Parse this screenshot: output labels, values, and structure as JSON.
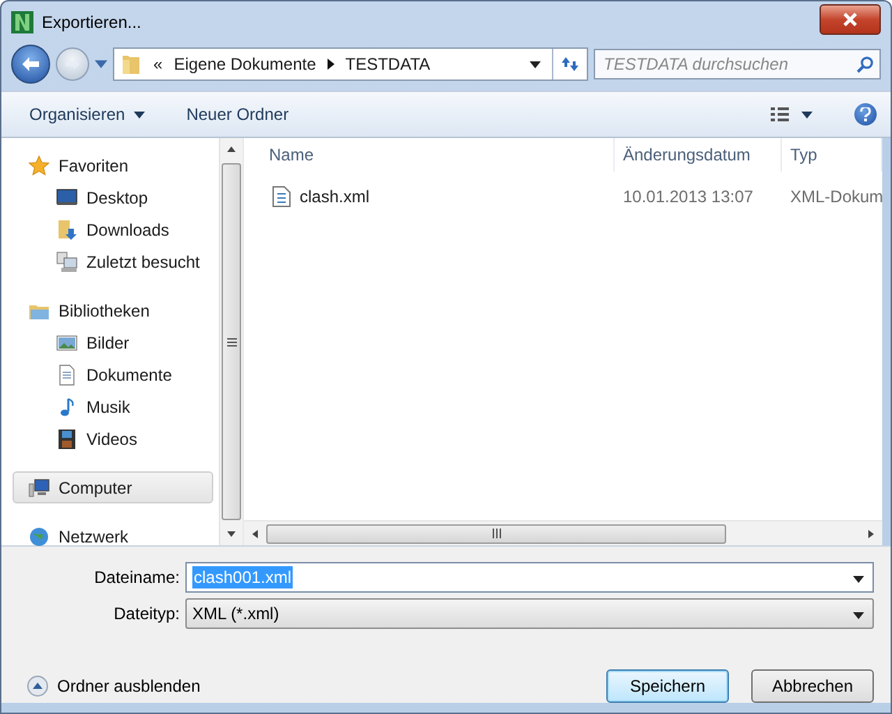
{
  "window": {
    "title": "Exportieren..."
  },
  "address": {
    "overflow": "«",
    "crumbs": [
      "Eigene Dokumente",
      "TESTDATA"
    ]
  },
  "search": {
    "placeholder": "TESTDATA durchsuchen"
  },
  "toolbar": {
    "organize": "Organisieren",
    "new_folder": "Neuer Ordner"
  },
  "sidebar": {
    "groups": [
      {
        "label": "Favoriten",
        "selected": false,
        "children": [
          {
            "label": "Desktop"
          },
          {
            "label": "Downloads"
          },
          {
            "label": "Zuletzt besucht"
          }
        ]
      },
      {
        "label": "Bibliotheken",
        "selected": false,
        "children": [
          {
            "label": "Bilder"
          },
          {
            "label": "Dokumente"
          },
          {
            "label": "Musik"
          },
          {
            "label": "Videos"
          }
        ]
      },
      {
        "label": "Computer",
        "selected": true
      },
      {
        "label": "Netzwerk",
        "selected": false
      }
    ]
  },
  "table": {
    "columns": [
      "Name",
      "Änderungsdatum",
      "Typ"
    ],
    "rows": [
      {
        "name": "clash.xml",
        "date": "10.01.2013 13:07",
        "type": "XML-Dokum"
      }
    ]
  },
  "form": {
    "filename_label": "Dateiname:",
    "filename": "clash001.xml",
    "filetype_label": "Dateityp:",
    "filetype": "XML (*.xml)"
  },
  "footer": {
    "toggle": "Ordner ausblenden",
    "save": "Speichern",
    "cancel": "Abbrechen"
  }
}
